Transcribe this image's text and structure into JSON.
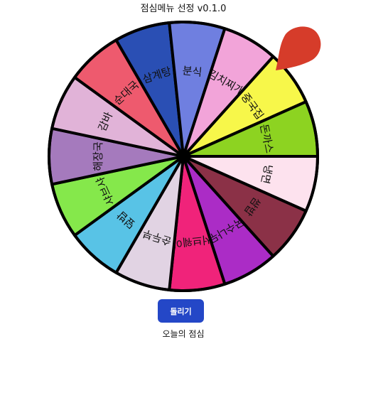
{
  "app": {
    "title": "점심메뉴 선정 v0.1.0",
    "spin_button": "돌리기",
    "result_label": "오늘의 점심"
  },
  "wheel": {
    "pointer_color": "#d63c2a",
    "segments": [
      {
        "label": "중국집",
        "color": "#f7f74a"
      },
      {
        "label": "돈까스",
        "color": "#8dd321"
      },
      {
        "label": "냉면",
        "color": "#fde2ee"
      },
      {
        "label": "쌈밥",
        "color": "#8b3147"
      },
      {
        "label": "국수나무",
        "color": "#ab2cc6"
      },
      {
        "label": "서브웨이",
        "color": "#f0237a"
      },
      {
        "label": "순두부",
        "color": "#e1d3e3"
      },
      {
        "label": "덮밥",
        "color": "#58c3e6"
      },
      {
        "label": "샤브샤",
        "color": "#85e84b"
      },
      {
        "label": "해장국",
        "color": "#a57abd"
      },
      {
        "label": "감바",
        "color": "#e1b3d8"
      },
      {
        "label": "순대국",
        "color": "#ee5a6e"
      },
      {
        "label": "삼계탕",
        "color": "#2a4fb4"
      },
      {
        "label": "분식",
        "color": "#6f7fe0"
      },
      {
        "label": "김치찌개",
        "color": "#f2a4d9"
      }
    ]
  }
}
